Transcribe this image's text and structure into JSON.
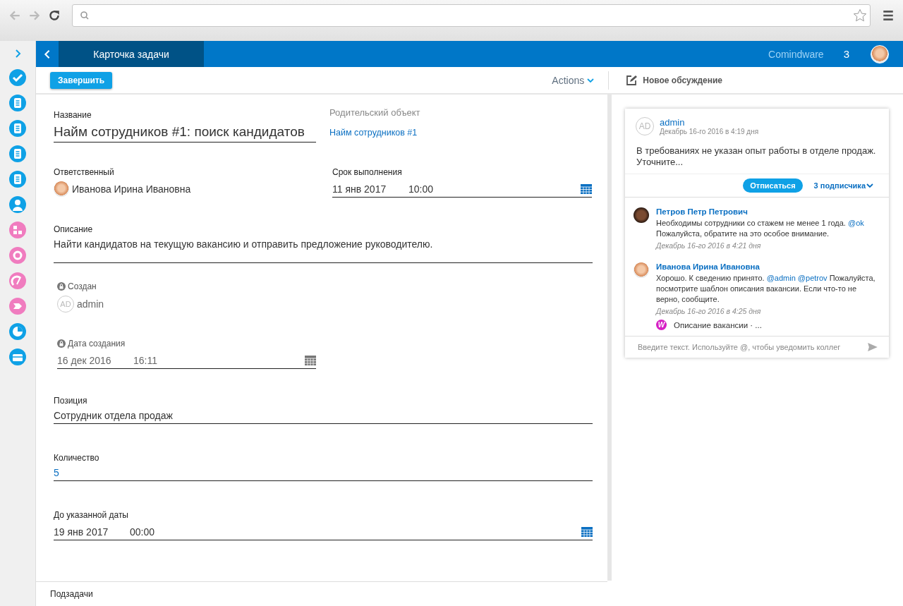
{
  "rail": {
    "items": [
      {
        "kind": "check",
        "color": "#0fa1e6"
      },
      {
        "kind": "doc",
        "color": "#0fa1e6"
      },
      {
        "kind": "doc",
        "color": "#0fa1e6"
      },
      {
        "kind": "doc",
        "color": "#0fa1e6"
      },
      {
        "kind": "doc",
        "color": "#0fa1e6"
      },
      {
        "kind": "person",
        "color": "#0fa1e6"
      },
      {
        "kind": "diagram",
        "color": "#f07cbf"
      },
      {
        "kind": "gear",
        "color": "#f07cbf"
      },
      {
        "kind": "chart",
        "color": "#f07cbf"
      },
      {
        "kind": "arrow",
        "color": "#f07cbf"
      },
      {
        "kind": "pie",
        "color": "#0fa1e6"
      },
      {
        "kind": "case",
        "color": "#0fa1e6"
      }
    ]
  },
  "header": {
    "title": "Карточка задачи",
    "brand": "Comindware",
    "count": "3"
  },
  "toolbar": {
    "complete": "Завершить",
    "actions": "Actions",
    "new_discussion": "Новое обсуждение"
  },
  "form": {
    "name": {
      "label": "Название",
      "value": "Найм сотрудников #1: поиск кандидатов"
    },
    "parent": {
      "label": "Родительский объект",
      "link": "Найм сотрудников #1"
    },
    "assignee": {
      "label": "Ответственный",
      "value": "Иванова Ирина Ивановна"
    },
    "due": {
      "label": "Срок выполнения",
      "date": "11 янв 2017",
      "time": "10:00"
    },
    "description": {
      "label": "Описание",
      "value": "Найти кандидатов на текущую вакансию и отправить предложение руководителю."
    },
    "created_by": {
      "label": "Создан",
      "locked": true,
      "initials": "AD",
      "value": "admin"
    },
    "created_date": {
      "label": "Дата создания",
      "locked": true,
      "date": "16 дек 2016",
      "time": "16:11"
    },
    "position": {
      "label": "Позиция",
      "value": "Сотрудник отдела продаж"
    },
    "quantity": {
      "label": "Количество",
      "value": "5"
    },
    "until": {
      "label": "До указанной даты",
      "date": "19 янв 2017",
      "time": "00:00"
    }
  },
  "subtasks": {
    "label": "Подзадачи"
  },
  "discussion": {
    "initials": "AD",
    "author": "admin",
    "date": "Декабрь 16-го 2016 в 4:19 дня",
    "text": "В требованиях не указан опыт работы в отделе продаж. Уточните...",
    "unsubscribe": "Отписаться",
    "subscribers": "3 подписчика",
    "comments": [
      {
        "author": "Петров Петр Петрович",
        "parts": [
          {
            "kind": "text",
            "text": "Необходимы сотрудники со стажем не менее 1 года. "
          },
          {
            "kind": "mention",
            "text": "@ok"
          },
          {
            "kind": "text",
            "text": " Пожалуйста, обратите на это особое внимание."
          }
        ],
        "date": "Декабрь 16-го 2016 в 4:21 дня"
      },
      {
        "author": "Иванова Ирина Ивановна",
        "parts": [
          {
            "kind": "text",
            "text": "Хорошо. К сведению принято. "
          },
          {
            "kind": "mention",
            "text": "@admin"
          },
          {
            "kind": "mention",
            "text": "@petrov"
          },
          {
            "kind": "text",
            "text": " Пожалуйста, посмотрите шаблон описания вакансии. Если что-то не верно, сообщите."
          }
        ],
        "date": "Декабрь 16-го 2016 в 4:25 дня",
        "attachment": {
          "icon": "W",
          "name": "Описание вакансии · ..."
        }
      }
    ],
    "input": {
      "placeholder": "Введите текст. Используйте @, чтобы уведомить коллег"
    }
  }
}
